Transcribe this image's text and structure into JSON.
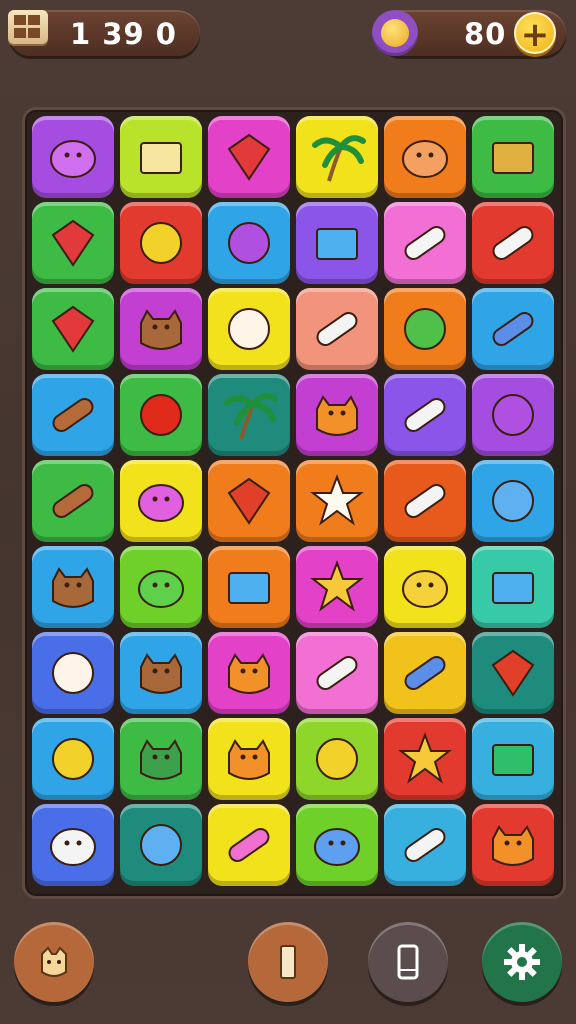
{
  "header": {
    "level_text": "1 39 0",
    "coin_count": "80",
    "plus_label": "+"
  },
  "colors": {
    "purple": "#a44de0",
    "lime": "#b9e22a",
    "magenta": "#e441c9",
    "yellow": "#f2e21c",
    "orange": "#f07c1c",
    "green": "#3dbb45",
    "red": "#e23a2e",
    "blue": "#2fa5e8",
    "violet": "#8a55e8",
    "pink": "#f26fd3",
    "salmon": "#f2937c",
    "teal": "#1f8b7c",
    "bright_green": "#6fd02a",
    "cyan": "#37c9e0"
  },
  "grid": [
    [
      "purple-blob-icon",
      "cheese-icon",
      "red-gem-icon",
      "palm-tree-icon",
      "orange-ghost-icon",
      "golden-crate-icon"
    ],
    [
      "striped-gem-icon",
      "yellow-fruit-icon",
      "spiky-ball-icon",
      "blue-box-icon",
      "feather-icon",
      "capsule-icon"
    ],
    [
      "red-diamond-icon",
      "bear-icon",
      "puffball-icon",
      "pencil-icon",
      "green-pear-icon",
      "blue-crayon-icon"
    ],
    [
      "wood-plank-icon",
      "red-ball-icon",
      "palm-tree-icon",
      "sun-creature-icon",
      "marker-icon",
      "purple-rattle-icon"
    ],
    [
      "orange-pill-icon",
      "pink-blob-icon",
      "red-leaf-icon",
      "white-star-icon",
      "marker-icon",
      "blue-oval-icon"
    ],
    [
      "brown-cat-icon",
      "green-slime-icon",
      "envelope-icon",
      "gold-star-icon",
      "yellow-ghost-icon",
      "sign-icon"
    ],
    [
      "snowball-icon",
      "brown-creature-icon",
      "orange-sun-icon",
      "crossed-tools-icon",
      "blue-plank-icon",
      "red-leaf-icon"
    ],
    [
      "lemon-icon",
      "green-dragon-icon",
      "orange-cat-icon",
      "mango-icon",
      "yellow-star-icon",
      "green-frame-icon"
    ],
    [
      "white-ghost-icon",
      "blue-rattle-icon",
      "pink-crayon-icon",
      "blue-blob-icon",
      "white-feather-icon",
      "orange-fluff-icon"
    ]
  ],
  "tile_colors": [
    [
      "#a44de0",
      "#b9e22a",
      "#e441c9",
      "#f2e21c",
      "#f07c1c",
      "#3dbb45"
    ],
    [
      "#3dbb45",
      "#e23a2e",
      "#2fa5e8",
      "#8a55e8",
      "#f26fd3",
      "#e23a2e"
    ],
    [
      "#3dbb45",
      "#c23fd1",
      "#f2e21c",
      "#f2937c",
      "#f07c1c",
      "#2fa5e8"
    ],
    [
      "#2fa5e8",
      "#3dbb45",
      "#1f8b7c",
      "#c23fd1",
      "#8a55e8",
      "#a44de0"
    ],
    [
      "#3dbb45",
      "#f2e21c",
      "#f07c1c",
      "#f07c1c",
      "#e85a1c",
      "#2fa5e8"
    ],
    [
      "#2fa5e8",
      "#6fd02a",
      "#f07c1c",
      "#e441c9",
      "#f2e21c",
      "#37c9a8"
    ],
    [
      "#4a6ee8",
      "#2fa5e8",
      "#e441c9",
      "#f26fd3",
      "#f2c21c",
      "#1f8b7c"
    ],
    [
      "#2fa5e8",
      "#3dbb45",
      "#f2e21c",
      "#8fd62a",
      "#e23a2e",
      "#37b0e0"
    ],
    [
      "#4a6ee8",
      "#1f8b7c",
      "#f2e21c",
      "#6fd02a",
      "#37b0e0",
      "#e23a2e"
    ]
  ],
  "bottom_buttons": [
    "creature-button",
    "card-button",
    "phone-button",
    "settings-button"
  ]
}
